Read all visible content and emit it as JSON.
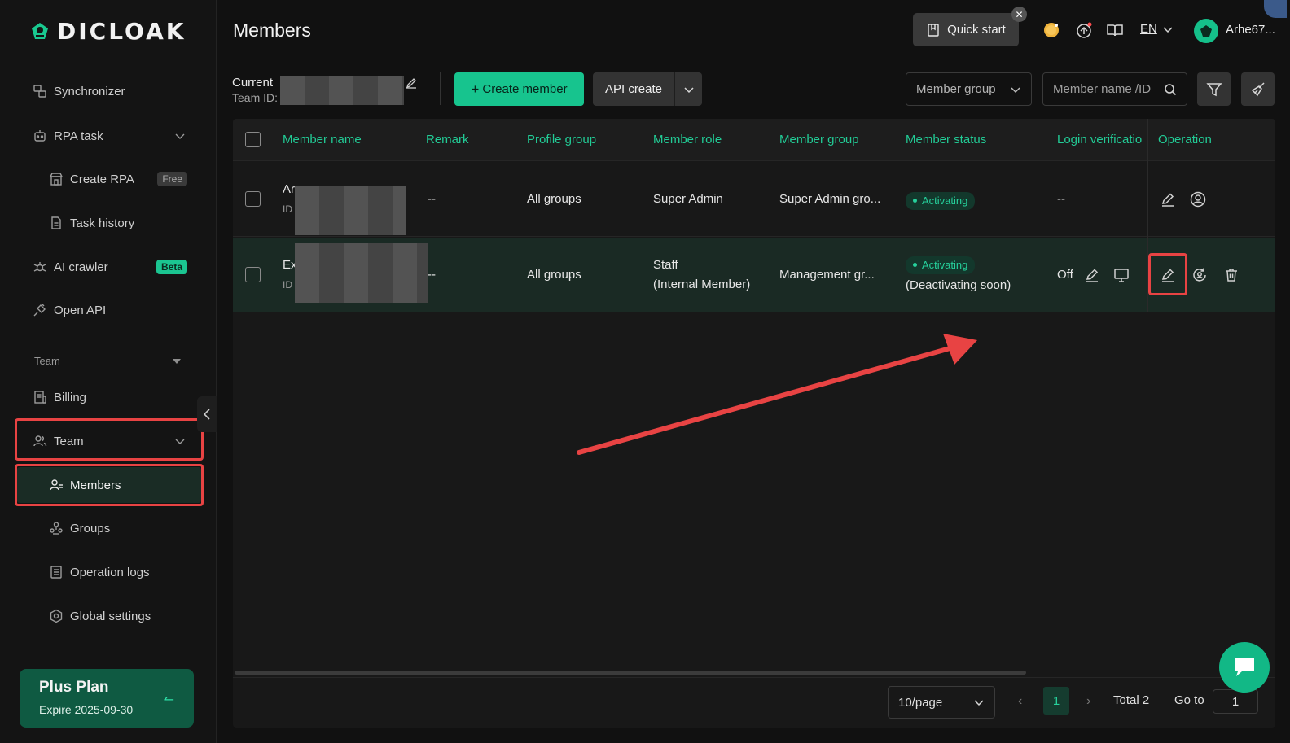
{
  "brand": {
    "name": "DICLOAK",
    "accent": "#17c48e"
  },
  "sidebar": {
    "items": [
      {
        "label": "Synchronizer",
        "icon": "sync-icon"
      },
      {
        "label": "RPA task",
        "icon": "robot-icon"
      },
      {
        "label": "Create RPA",
        "icon": "store-icon",
        "badge": "Free"
      },
      {
        "label": "Task history",
        "icon": "document-icon"
      },
      {
        "label": "AI crawler",
        "icon": "spider-icon",
        "badge": "Beta"
      },
      {
        "label": "Open API",
        "icon": "plug-icon"
      }
    ],
    "section_label": "Team",
    "team_items": [
      {
        "label": "Billing",
        "icon": "invoice-icon"
      },
      {
        "label": "Team",
        "icon": "users-icon"
      },
      {
        "label": "Members",
        "icon": "member-icon"
      },
      {
        "label": "Groups",
        "icon": "groups-icon"
      },
      {
        "label": "Operation logs",
        "icon": "logs-icon"
      },
      {
        "label": "Global settings",
        "icon": "settings-icon"
      }
    ],
    "plan": {
      "title": "Plus Plan",
      "expire": "Expire 2025-09-30"
    }
  },
  "header": {
    "title": "Members",
    "quick_start": "Quick start",
    "language": "EN",
    "username": "Arhe67..."
  },
  "toolbar": {
    "current_label": "Current",
    "team_id_label": "Team ID:",
    "create_member": "Create member",
    "api_create": "API create",
    "member_group_placeholder": "Member group",
    "search_placeholder": "Member name /ID"
  },
  "table": {
    "columns": [
      "Member name",
      "Remark",
      "Profile group",
      "Member role",
      "Member group",
      "Member status",
      "Login verificatio",
      "Operation"
    ],
    "rows": [
      {
        "name_prefix": "Ar",
        "id_prefix": "ID",
        "remark": "--",
        "profile_group": "All groups",
        "role": "Super Admin",
        "role_sub": "",
        "member_group": "Super Admin gro...",
        "status": "Activating",
        "status_note": "",
        "login_verification": "--"
      },
      {
        "name_prefix": "Ex",
        "id_prefix": "ID",
        "remark": "--",
        "profile_group": "All groups",
        "role": "Staff",
        "role_sub": "(Internal Member)",
        "member_group": "Management gr...",
        "status": "Activating",
        "status_note": "(Deactivating soon)",
        "login_verification": "Off"
      }
    ]
  },
  "pagination": {
    "per_page": "10/page",
    "current_page": "1",
    "total": "Total 2",
    "goto_label": "Go to",
    "goto_value": "1"
  }
}
